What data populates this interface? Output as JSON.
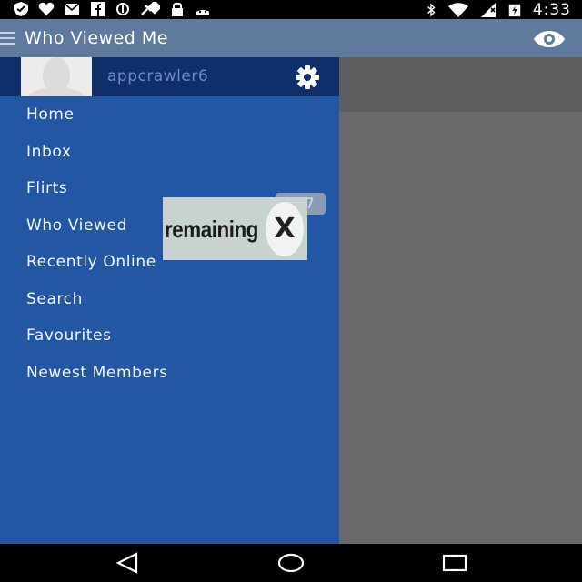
{
  "status_bar": {
    "time": "4:33",
    "icons": [
      "shield-icon",
      "heart-icon",
      "mail-icon",
      "facebook-icon",
      "circle-icon",
      "satellite-icon",
      "lock-icon",
      "android-icon",
      "bluetooth-icon",
      "wifi-icon",
      "no-sim-icon",
      "battery-icon"
    ]
  },
  "action_bar": {
    "title": "Who Viewed Me",
    "menu_icon": "hamburger-icon",
    "action_icon": "eye-icon"
  },
  "drawer": {
    "username": "appcrawler6",
    "settings_icon": "gear-icon",
    "items": [
      {
        "label": "Home"
      },
      {
        "label": "Inbox"
      },
      {
        "label": "Flirts"
      },
      {
        "label": "Who Viewed"
      },
      {
        "label": "Recently Online"
      },
      {
        "label": "Search"
      },
      {
        "label": "Favourites"
      },
      {
        "label": "Newest Members"
      }
    ],
    "badge": "777"
  },
  "ad_overlay": {
    "text": "remaining",
    "close_label": "X"
  },
  "nav_bar": {
    "icons": [
      "back-icon",
      "home-icon",
      "recents-icon"
    ]
  }
}
